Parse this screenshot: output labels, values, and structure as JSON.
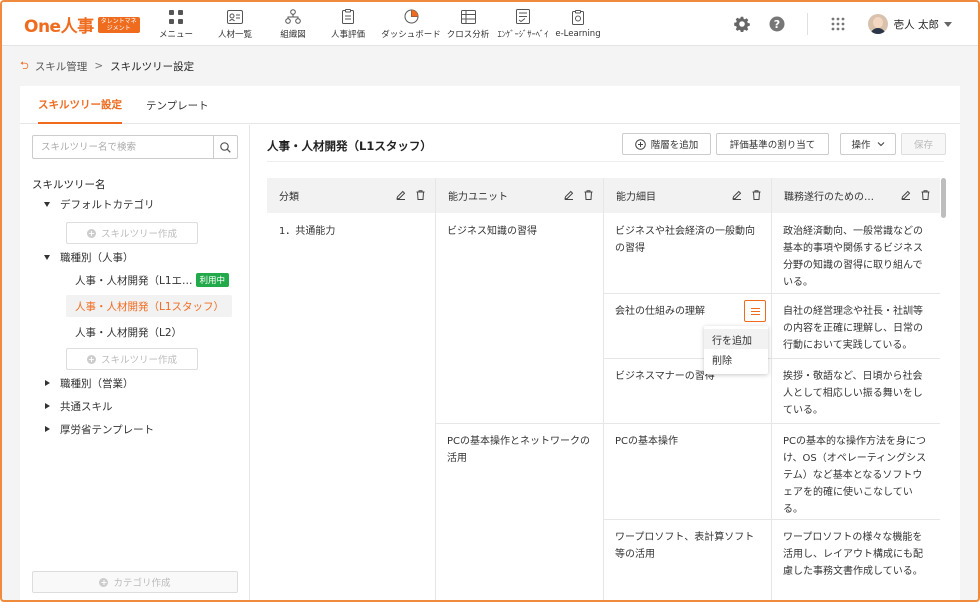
{
  "brand": {
    "name": "One人事",
    "badge": "タレントマネジメント",
    "accent": "#ef6c1f"
  },
  "nav": [
    {
      "label": "メニュー",
      "icon": "grid-icon"
    },
    {
      "label": "人材一覧",
      "icon": "id-card-icon"
    },
    {
      "label": "組織図",
      "icon": "org-chart-icon"
    },
    {
      "label": "人事評価",
      "icon": "clipboard-icon"
    },
    {
      "label": "ダッシュボード",
      "icon": "pie-chart-icon"
    },
    {
      "label": "クロス分析",
      "icon": "table-icon"
    },
    {
      "label": "ｴﾝｹﾞｰｼﾞｻｰﾍﾞｲ",
      "icon": "survey-icon"
    },
    {
      "label": "e-Learning",
      "icon": "learning-icon"
    }
  ],
  "header_right": {
    "user_name": "壱人 太郎"
  },
  "breadcrumb": {
    "parent": "スキル管理",
    "separator": ">",
    "current": "スキルツリー設定"
  },
  "tabs": [
    {
      "label": "スキルツリー設定",
      "active": true
    },
    {
      "label": "テンプレート",
      "active": false
    }
  ],
  "left": {
    "search_placeholder": "スキルツリー名で検索",
    "tree_title": "スキルツリー名",
    "default_category": "デフォルトカテゴリ",
    "create_tree": "スキルツリー作成",
    "hr_category": "職種別（人事）",
    "leaf1": "人事・人材開発（L1エ…",
    "leaf1_badge": "利用中",
    "leaf2": "人事・人材開発（L1スタッフ）",
    "leaf3": "人事・人材開発（L2）",
    "sales_category": "職種別（営業）",
    "common_skill": "共通スキル",
    "mhlw_template": "厚労省テンプレート",
    "create_category": "カテゴリ作成"
  },
  "right": {
    "title": "人事・人材開発（L1スタッフ）",
    "add_level": "階層を追加",
    "assign_criteria": "評価基準の割り当て",
    "operations": "操作",
    "save": "保存"
  },
  "table": {
    "columns": [
      "分類",
      "能力ユニット",
      "能力細目",
      "職務遂行のための…"
    ],
    "category": "1．共通能力",
    "units": [
      "ビジネス知識の習得",
      "PCの基本操作とネットワークの活用"
    ],
    "rows": [
      {
        "detail": "ビジネスや社会経済の一般動向の習得",
        "desc": "政治経済動向、一般常識などの基本的事項や関係するビジネス分野の知識の習得に取り組んでいる。"
      },
      {
        "detail": "会社の仕組みの理解",
        "desc": "自社の経営理念や社長・社訓等の内容を正確に理解し、日常の行動において実践している。"
      },
      {
        "detail": "ビジネスマナーの習得",
        "desc": "挨拶・敬語など、日頃から社会人として相応しい振る舞いをしている。"
      },
      {
        "detail": "PCの基本操作",
        "desc": "PCの基本的な操作方法を身につけ、OS（オペレーティングシステム）など基本となるソフトウェアを的確に使いこなしている。"
      },
      {
        "detail": "ワープロソフト、表計算ソフト等の活用",
        "desc": "ワープロソフトの様々な機能を活用し、レイアウト構成にも配慮した事務文書作成している。"
      }
    ],
    "context_menu": [
      "行を追加",
      "削除"
    ]
  }
}
